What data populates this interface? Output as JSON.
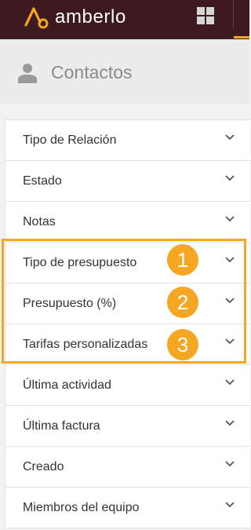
{
  "app": {
    "name": "amberlo"
  },
  "page": {
    "title": "Contactos"
  },
  "filters": {
    "items": [
      {
        "label": "Tipo de Relación"
      },
      {
        "label": "Estado"
      },
      {
        "label": "Notas"
      },
      {
        "label": "Tipo de presupuesto"
      },
      {
        "label": "Presupuesto (%)"
      },
      {
        "label": "Tarifas personalizadas"
      },
      {
        "label": "Última actividad"
      },
      {
        "label": "Última factura"
      },
      {
        "label": "Creado"
      },
      {
        "label": "Miembros del equipo"
      }
    ]
  },
  "annotations": {
    "steps": [
      "1",
      "2",
      "3"
    ]
  },
  "icons": {
    "logo": "amberlo-logo-icon",
    "apps": "grid-icon",
    "person": "person-icon",
    "chevron": "chevron-down-icon"
  },
  "colors": {
    "topbar": "#3d1a20",
    "accent": "#f5a623",
    "highlight": "#f5a623"
  }
}
